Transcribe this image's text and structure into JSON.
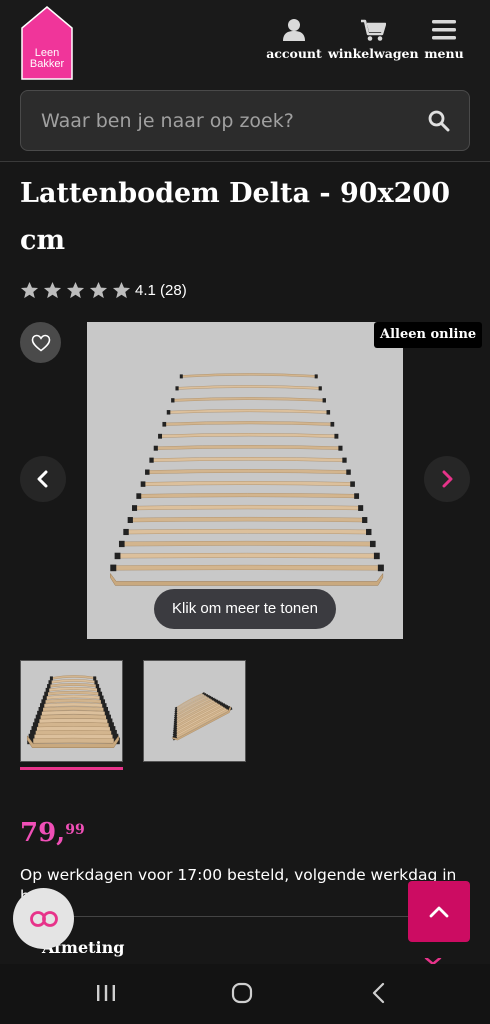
{
  "brand": {
    "logo_text_line1": "Leen",
    "logo_text_line2": "Bakker",
    "accent_color": "#e7338a",
    "logo_color": "#f0359a"
  },
  "header": {
    "nav": [
      {
        "label": "account",
        "icon": "user-icon"
      },
      {
        "label": "winkelwagen",
        "icon": "cart-icon"
      },
      {
        "label": "menu",
        "icon": "hamburger-menu-icon"
      }
    ]
  },
  "search": {
    "placeholder": "Waar ben je naar op zoek?",
    "value": ""
  },
  "product": {
    "title": "Lattenbodem Delta - 90x200 cm",
    "rating_value": "4.1",
    "rating_count": "(28)",
    "stars": 4.1,
    "badge": "Alleen online",
    "show_more_label": "Klik om meer te tonen",
    "price_main": "79,",
    "price_cents": "99",
    "price_color": "#f04fb7",
    "delivery_text": "Op werkdagen voor 17:00 besteld, volgende werkdag in",
    "delivery_text_2": "h",
    "spec_heading": "Afmeting"
  },
  "gallery": {
    "thumbnails": [
      {
        "selected": true
      },
      {
        "selected": false
      }
    ]
  }
}
